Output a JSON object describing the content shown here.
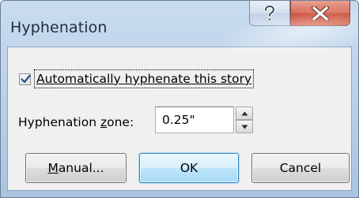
{
  "dialog": {
    "title": "Hyphenation",
    "help_glyph": "?",
    "close_glyph": "X",
    "help_icon": "question-mark-icon",
    "close_icon": "close-x-icon"
  },
  "options": {
    "auto_hyphenate": {
      "checked": true,
      "label_prefix": "",
      "label_mnemonic": "A",
      "label_rest": "utomatically hyphenate this story"
    },
    "zone": {
      "label_prefix": "Hyphenation ",
      "label_mnemonic": "z",
      "label_rest": "one:",
      "value": "0.25\""
    }
  },
  "buttons": {
    "manual_mnemonic": "M",
    "manual_rest": "anual...",
    "ok_label": "OK",
    "cancel_label": "Cancel"
  },
  "colors": {
    "title_bar": "#bdd3ea",
    "close_button": "#c7402a",
    "client_bg": "#f0f0f0",
    "default_button_border": "#3c7fb1"
  }
}
